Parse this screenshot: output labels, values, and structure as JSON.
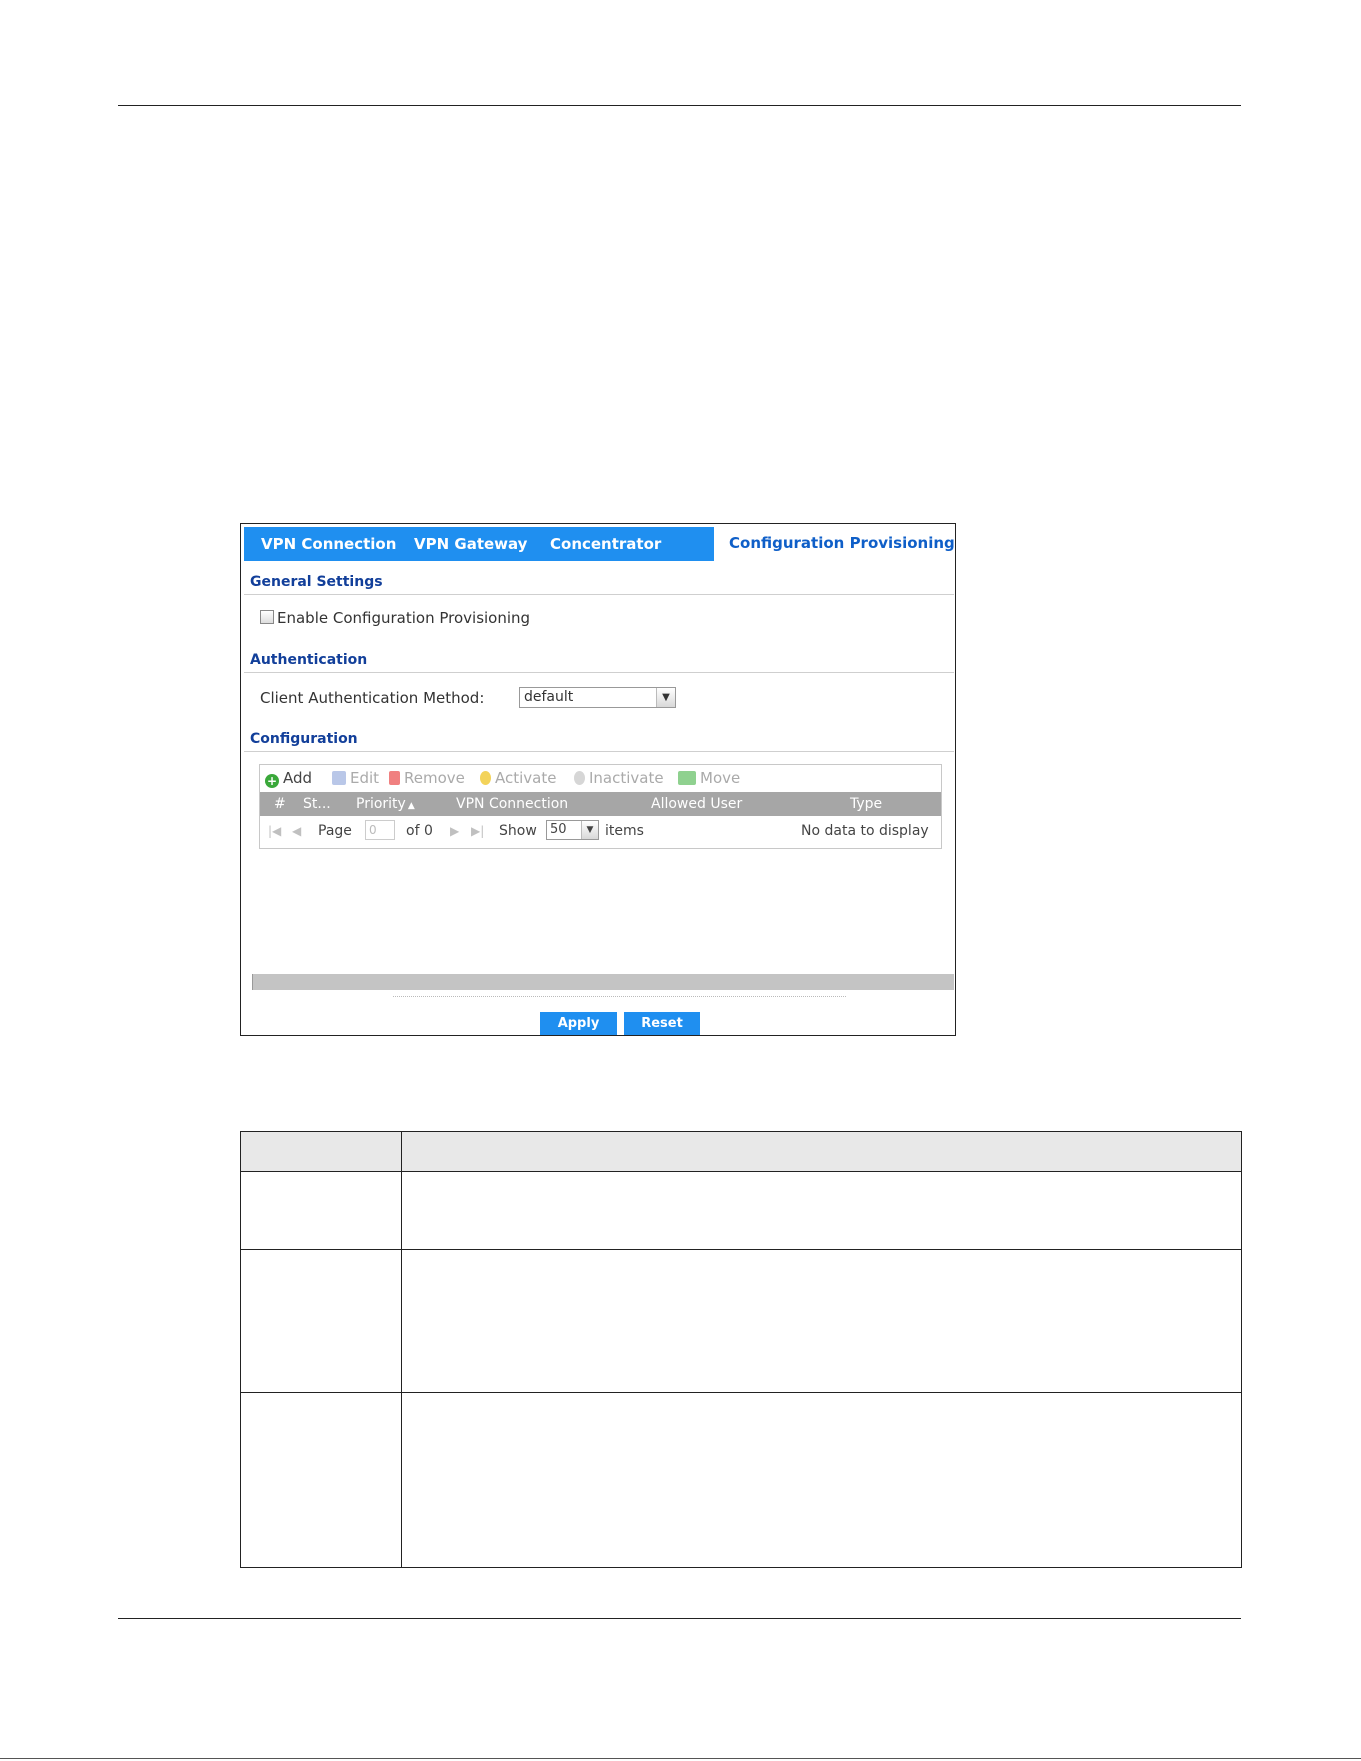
{
  "tabs": [
    {
      "label": "VPN Connection"
    },
    {
      "label": "VPN Gateway"
    },
    {
      "label": "Concentrator"
    },
    {
      "label": "Configuration Provisioning"
    }
  ],
  "general_settings": {
    "title": "General Settings",
    "enable_label": "Enable Configuration Provisioning",
    "enabled": false
  },
  "authentication": {
    "title": "Authentication",
    "method_label": "Client Authentication Method:",
    "method_value": "default"
  },
  "configuration": {
    "title": "Configuration",
    "toolbar": {
      "add": "Add",
      "edit": "Edit",
      "remove": "Remove",
      "activate": "Activate",
      "inactivate": "Inactivate",
      "move": "Move"
    },
    "columns": [
      "#",
      "St...",
      "Priority",
      "VPN Connection",
      "Allowed User",
      "Type"
    ],
    "sort_indicator": "▲",
    "pager": {
      "page_label": "Page",
      "page_value": "0",
      "of_label": "of 0",
      "show_label": "Show",
      "show_value": "50",
      "items_label": "items",
      "empty_message": "No data to display"
    }
  },
  "buttons": {
    "apply": "Apply",
    "reset": "Reset"
  },
  "colors": {
    "tab_bar": "#1f8ff0",
    "section_title": "#123f9a",
    "header_gray": "#a6a6a6"
  }
}
